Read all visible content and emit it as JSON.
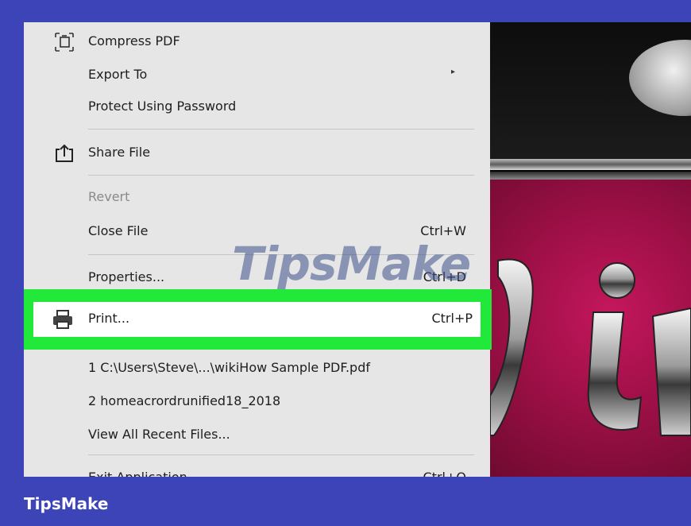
{
  "menu": {
    "compress_pdf": "Compress PDF",
    "export_to": "Export To",
    "protect": "Protect Using Password",
    "share_file": "Share File",
    "revert": "Revert",
    "close_file": "Close File",
    "close_file_shortcut": "Ctrl+W",
    "properties": "Properties...",
    "properties_shortcut": "Ctrl+D",
    "print": "Print...",
    "print_shortcut": "Ctrl+P",
    "recent_1": "1 C:\\Users\\Steve\\...\\wikiHow Sample PDF.pdf",
    "recent_2": "2 homeacrordrunified18_2018",
    "view_all_recent": "View All Recent Files...",
    "exit_application": "Exit Application",
    "exit_shortcut": "Ctrl+Q"
  },
  "icons": {
    "compress": "compress-icon",
    "share": "share-icon",
    "print": "printer-icon",
    "submenu": "submenu-arrow-icon"
  },
  "colors": {
    "highlight": "#22e83a",
    "frame": "#3c44b8",
    "menu_bg": "#e6e6e6"
  },
  "watermark": "TipsMake",
  "brand": "TipsMake"
}
